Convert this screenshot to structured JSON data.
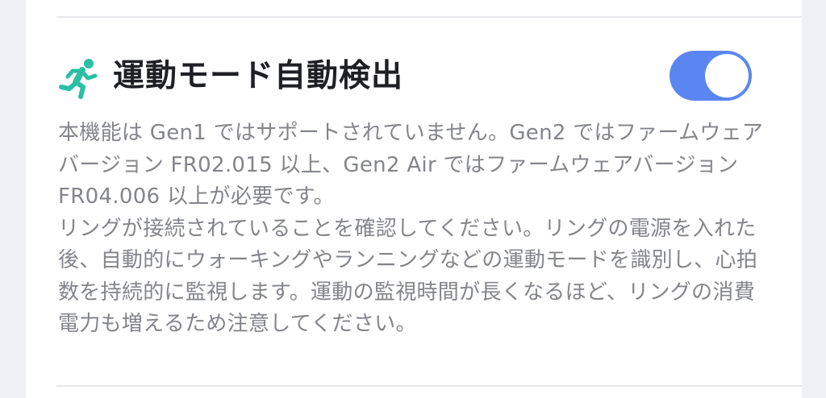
{
  "setting": {
    "icon": "running-person-icon",
    "title": "運動モード自動検出",
    "toggle_on": true,
    "accent_color": "#5b86f2",
    "icon_color": "#2bbfa4",
    "description_paragraphs": [
      "本機能は Gen1 ではサポートされていません。Gen2 ではファームウェアバージョン FR02.015 以上、Gen2 Air ではファームウェアバージョン FR04.006 以上が必要です。",
      "リングが接続されていることを確認してください。リングの電源を入れた後、自動的にウォーキングやランニングなどの運動モードを識別し、心拍数を持続的に監視します。運動の監視時間が長くなるほど、リングの消費電力も増えるため注意してください。"
    ]
  }
}
